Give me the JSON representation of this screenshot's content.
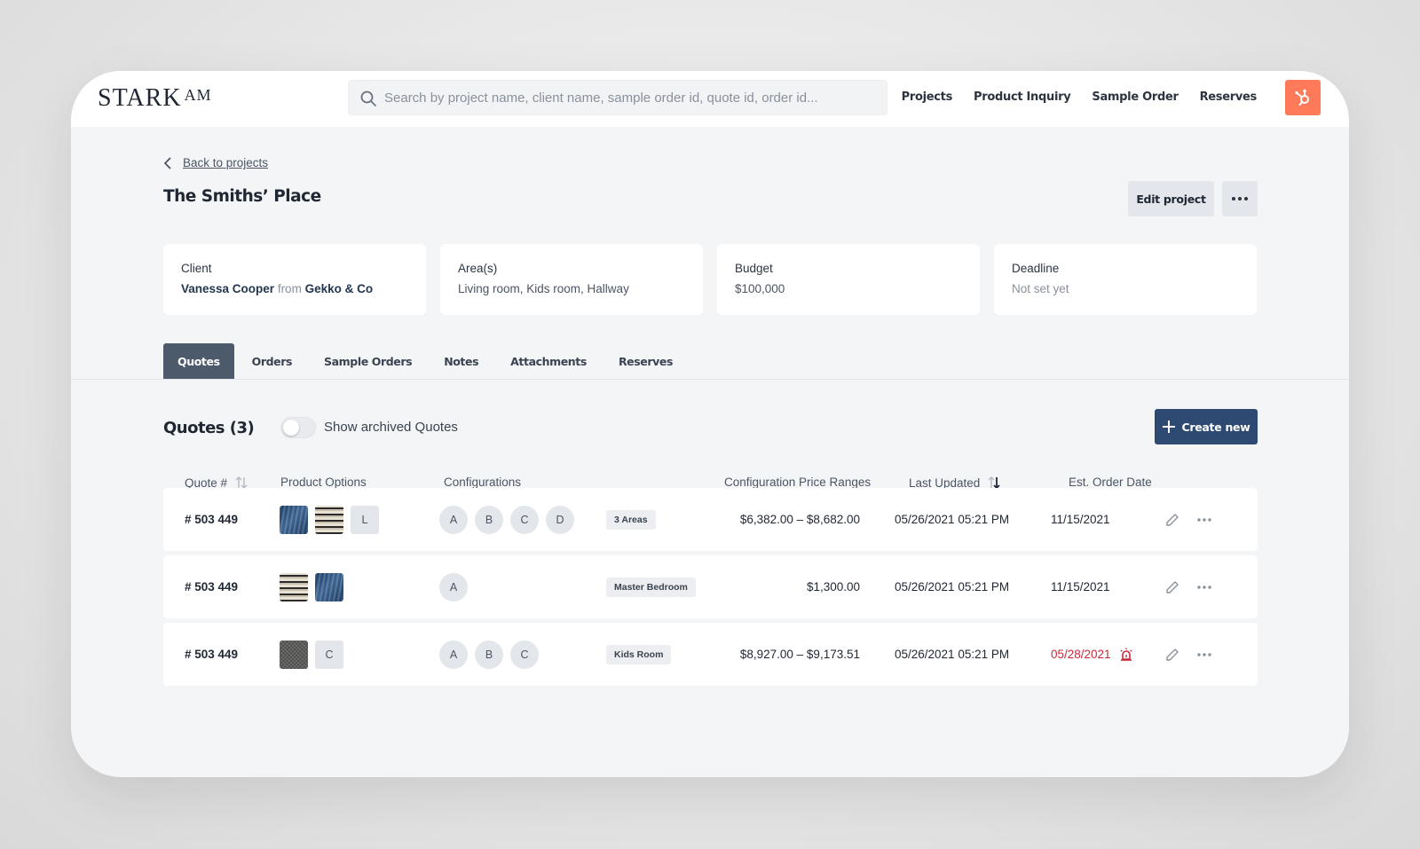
{
  "brand": {
    "name": "STARK",
    "suffix": "AM"
  },
  "search": {
    "placeholder": "Search by project name, client name, sample order id, quote id, order id..."
  },
  "nav": [
    "Projects",
    "Product Inquiry",
    "Sample Order",
    "Reserves"
  ],
  "colors": {
    "hubspot": "#ff7a59",
    "primary": "#2e4a73",
    "active_tab": "#4d5a6b",
    "overdue": "#c8283a"
  },
  "back_link": "Back to projects",
  "project": {
    "title": "The Smiths’ Place"
  },
  "actions": {
    "edit": "Edit project"
  },
  "cards": {
    "client": {
      "label": "Client",
      "name": "Vanessa Cooper",
      "from": "from",
      "company": "Gekko & Co"
    },
    "areas": {
      "label": "Area(s)",
      "value": "Living room, Kids room, Hallway"
    },
    "budget": {
      "label": "Budget",
      "value": "$100,000"
    },
    "deadline": {
      "label": "Deadline",
      "value": "Not set yet"
    }
  },
  "tabs": [
    "Quotes",
    "Orders",
    "Sample Orders",
    "Notes",
    "Attachments",
    "Reserves"
  ],
  "active_tab": "Quotes",
  "quotes": {
    "title": "Quotes (3)",
    "toggle_label": "Show archived Quotes",
    "toggle_on": false,
    "create_label": "Create new",
    "columns": {
      "quote": "Quote #",
      "options": "Product Options",
      "configs": "Configurations",
      "prices": "Configuration Price Ranges",
      "updated": "Last Updated",
      "est": "Est. Order Date"
    },
    "rows": [
      {
        "number": "# 503 449",
        "options_letter": "L",
        "configs": [
          "A",
          "B",
          "C",
          "D"
        ],
        "area": "3 Areas",
        "price": "$6,382.00 – $8,682.00",
        "updated": "05/26/2021 05:21 PM",
        "est": "11/15/2021"
      },
      {
        "number": "# 503 449",
        "configs": [
          "A"
        ],
        "area": "Master Bedroom",
        "price": "$1,300.00",
        "updated": "05/26/2021 05:21 PM",
        "est": "11/15/2021"
      },
      {
        "number": "# 503 449",
        "options_letter": "C",
        "configs": [
          "A",
          "B",
          "C"
        ],
        "area": "Kids Room",
        "price": "$8,927.00 – $9,173.51",
        "updated": "05/26/2021 05:21 PM",
        "est": "05/28/2021"
      }
    ]
  }
}
